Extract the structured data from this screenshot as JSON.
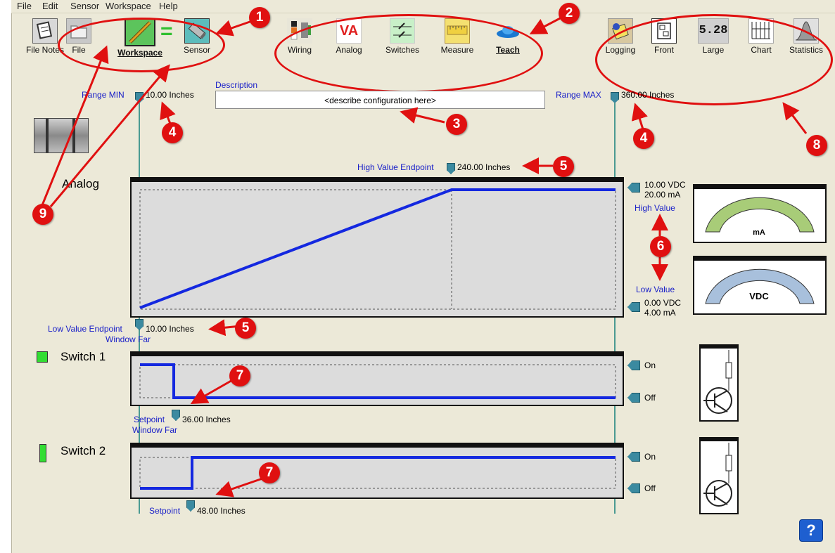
{
  "menu": [
    "File",
    "Edit",
    "Sensor",
    "Workspace",
    "Help"
  ],
  "toolbar_left": [
    {
      "label": "File Notes",
      "icon": "notes-icon"
    },
    {
      "label": "File",
      "icon": "folder-icon"
    },
    {
      "label": "Workspace",
      "icon": "pencil-icon"
    },
    {
      "label": "Sensor",
      "icon": "sensor-icon"
    }
  ],
  "equals_sign": "=",
  "toolbar_mid": [
    {
      "label": "Wiring",
      "icon": "wiring-icon"
    },
    {
      "label": "Analog",
      "icon": "analog-va-icon",
      "text": "VA"
    },
    {
      "label": "Switches",
      "icon": "switches-icon"
    },
    {
      "label": "Measure",
      "icon": "ruler-icon"
    },
    {
      "label": "Teach",
      "icon": "teach-icon"
    }
  ],
  "toolbar_right": [
    {
      "label": "Logging",
      "icon": "logging-icon"
    },
    {
      "label": "Front",
      "icon": "front-icon"
    },
    {
      "label": "Large",
      "icon": "large-display-icon",
      "text": "5.28"
    },
    {
      "label": "Chart",
      "icon": "chart-icon"
    },
    {
      "label": "Statistics",
      "icon": "statistics-icon"
    }
  ],
  "workspace": {
    "range_min_label": "Range MIN",
    "range_min_value": "10.00 Inches",
    "range_max_label": "Range MAX",
    "range_max_value": "360.00 Inches",
    "description_label": "Description",
    "description_value": "<describe configuration here>"
  },
  "analog": {
    "title": "Analog",
    "high_endpoint_label": "High Value Endpoint",
    "high_endpoint_value": "240.00 Inches",
    "low_endpoint_label": "Low Value Endpoint",
    "low_endpoint_value": "10.00 Inches",
    "window_far": "Window Far",
    "high_vdc": "10.00 VDC",
    "high_ma": "20.00 mA",
    "high_value_label": "High Value",
    "low_value_label": "Low Value",
    "low_vdc": "0.00 VDC",
    "low_ma": "4.00 mA",
    "meter_ma_unit": "mA",
    "meter_vdc_unit": "VDC"
  },
  "switch1": {
    "title": "Switch 1",
    "on": "On",
    "off": "Off",
    "setpoint_label": "Setpoint",
    "setpoint_value": "36.00 Inches",
    "window_far": "Window Far",
    "indicator_color": "#33dd33"
  },
  "switch2": {
    "title": "Switch 2",
    "on": "On",
    "off": "Off",
    "setpoint_label": "Setpoint",
    "setpoint_value": "48.00 Inches",
    "indicator_color": "#33dd33"
  },
  "annotations": [
    "1",
    "2",
    "3",
    "4",
    "4",
    "5",
    "5",
    "6",
    "7",
    "7",
    "8",
    "9"
  ],
  "help_icon_text": "?",
  "colors": {
    "accent_red": "#e01010",
    "signal_blue": "#1428e0",
    "link_blue": "#1a20c8"
  }
}
